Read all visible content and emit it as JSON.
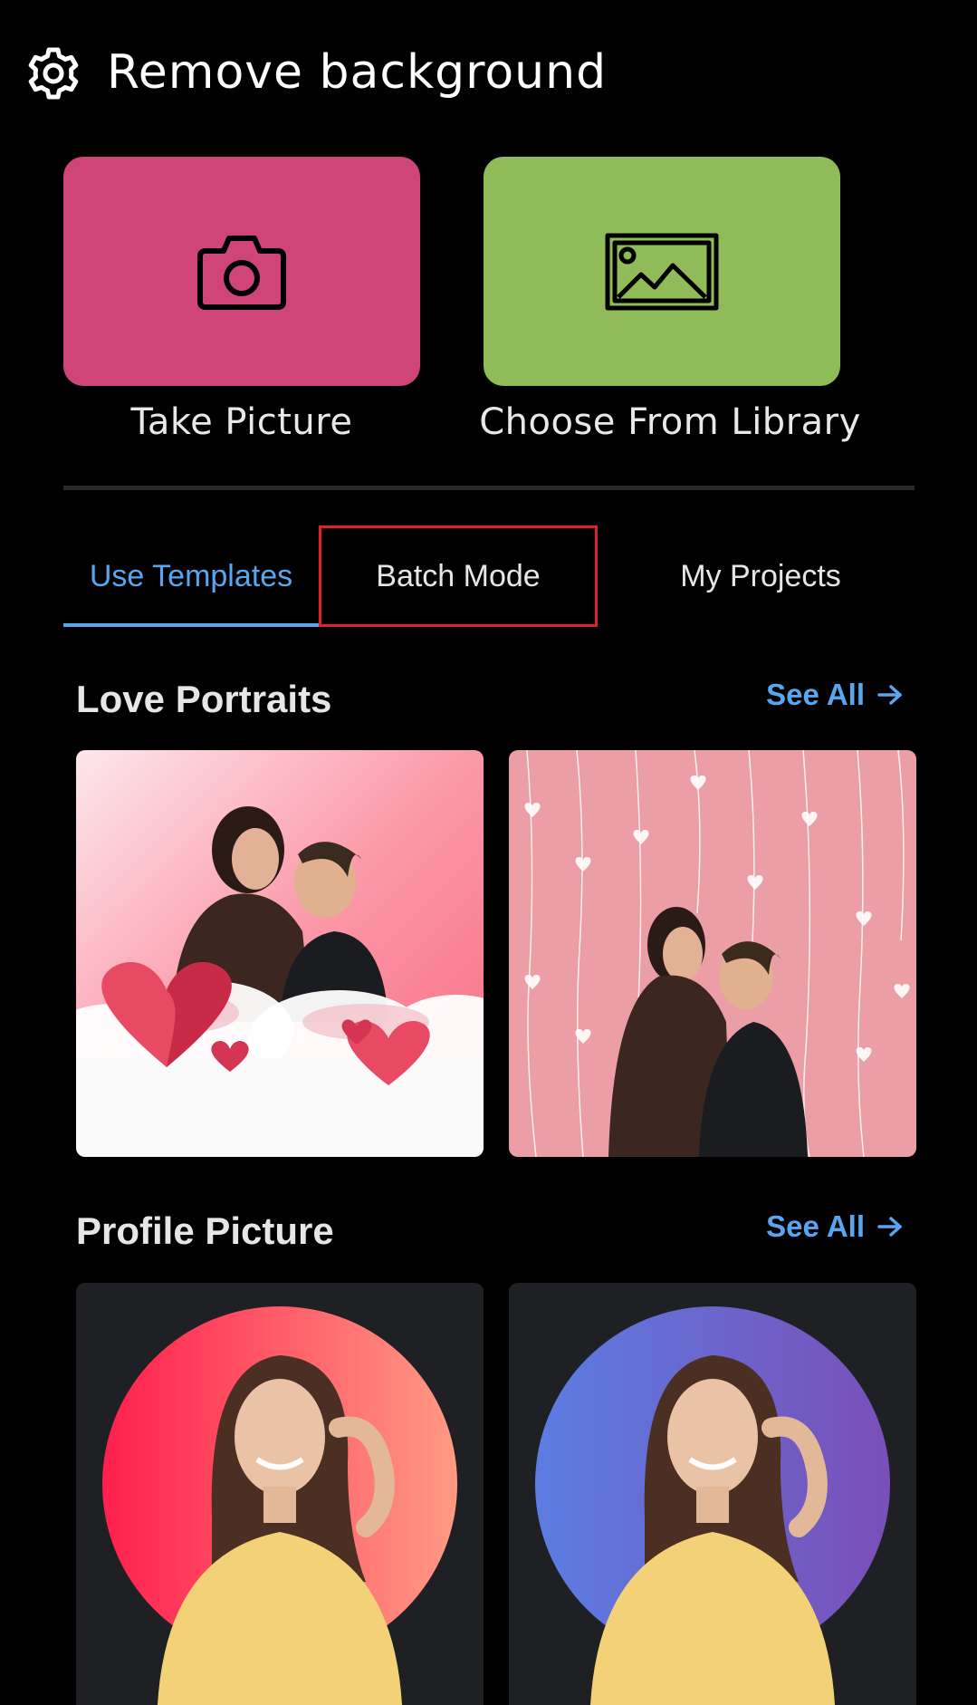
{
  "header": {
    "title": "Remove background",
    "settings_icon": "gear-icon"
  },
  "actions": {
    "take_picture": {
      "label": "Take Picture",
      "icon": "camera-icon",
      "color": "#cf4577"
    },
    "choose_library": {
      "label": "Choose From Library",
      "icon": "image-icon",
      "color": "#8fbb58"
    }
  },
  "tabs": [
    {
      "label": "Use Templates",
      "active": true
    },
    {
      "label": "Batch Mode",
      "highlighted": true
    },
    {
      "label": "My Projects"
    }
  ],
  "sections": [
    {
      "title": "Love Portraits",
      "see_all": "See All",
      "templates": [
        {
          "name": "pink hearts clouds"
        },
        {
          "name": "pink hanging hearts"
        }
      ]
    },
    {
      "title": "Profile Picture",
      "see_all": "See All",
      "templates": [
        {
          "name": "red pink gradient circle"
        },
        {
          "name": "blue purple gradient circle"
        }
      ]
    }
  ],
  "colors": {
    "accent": "#58a6f0",
    "highlight_box": "#e0202a",
    "background": "#000000"
  }
}
